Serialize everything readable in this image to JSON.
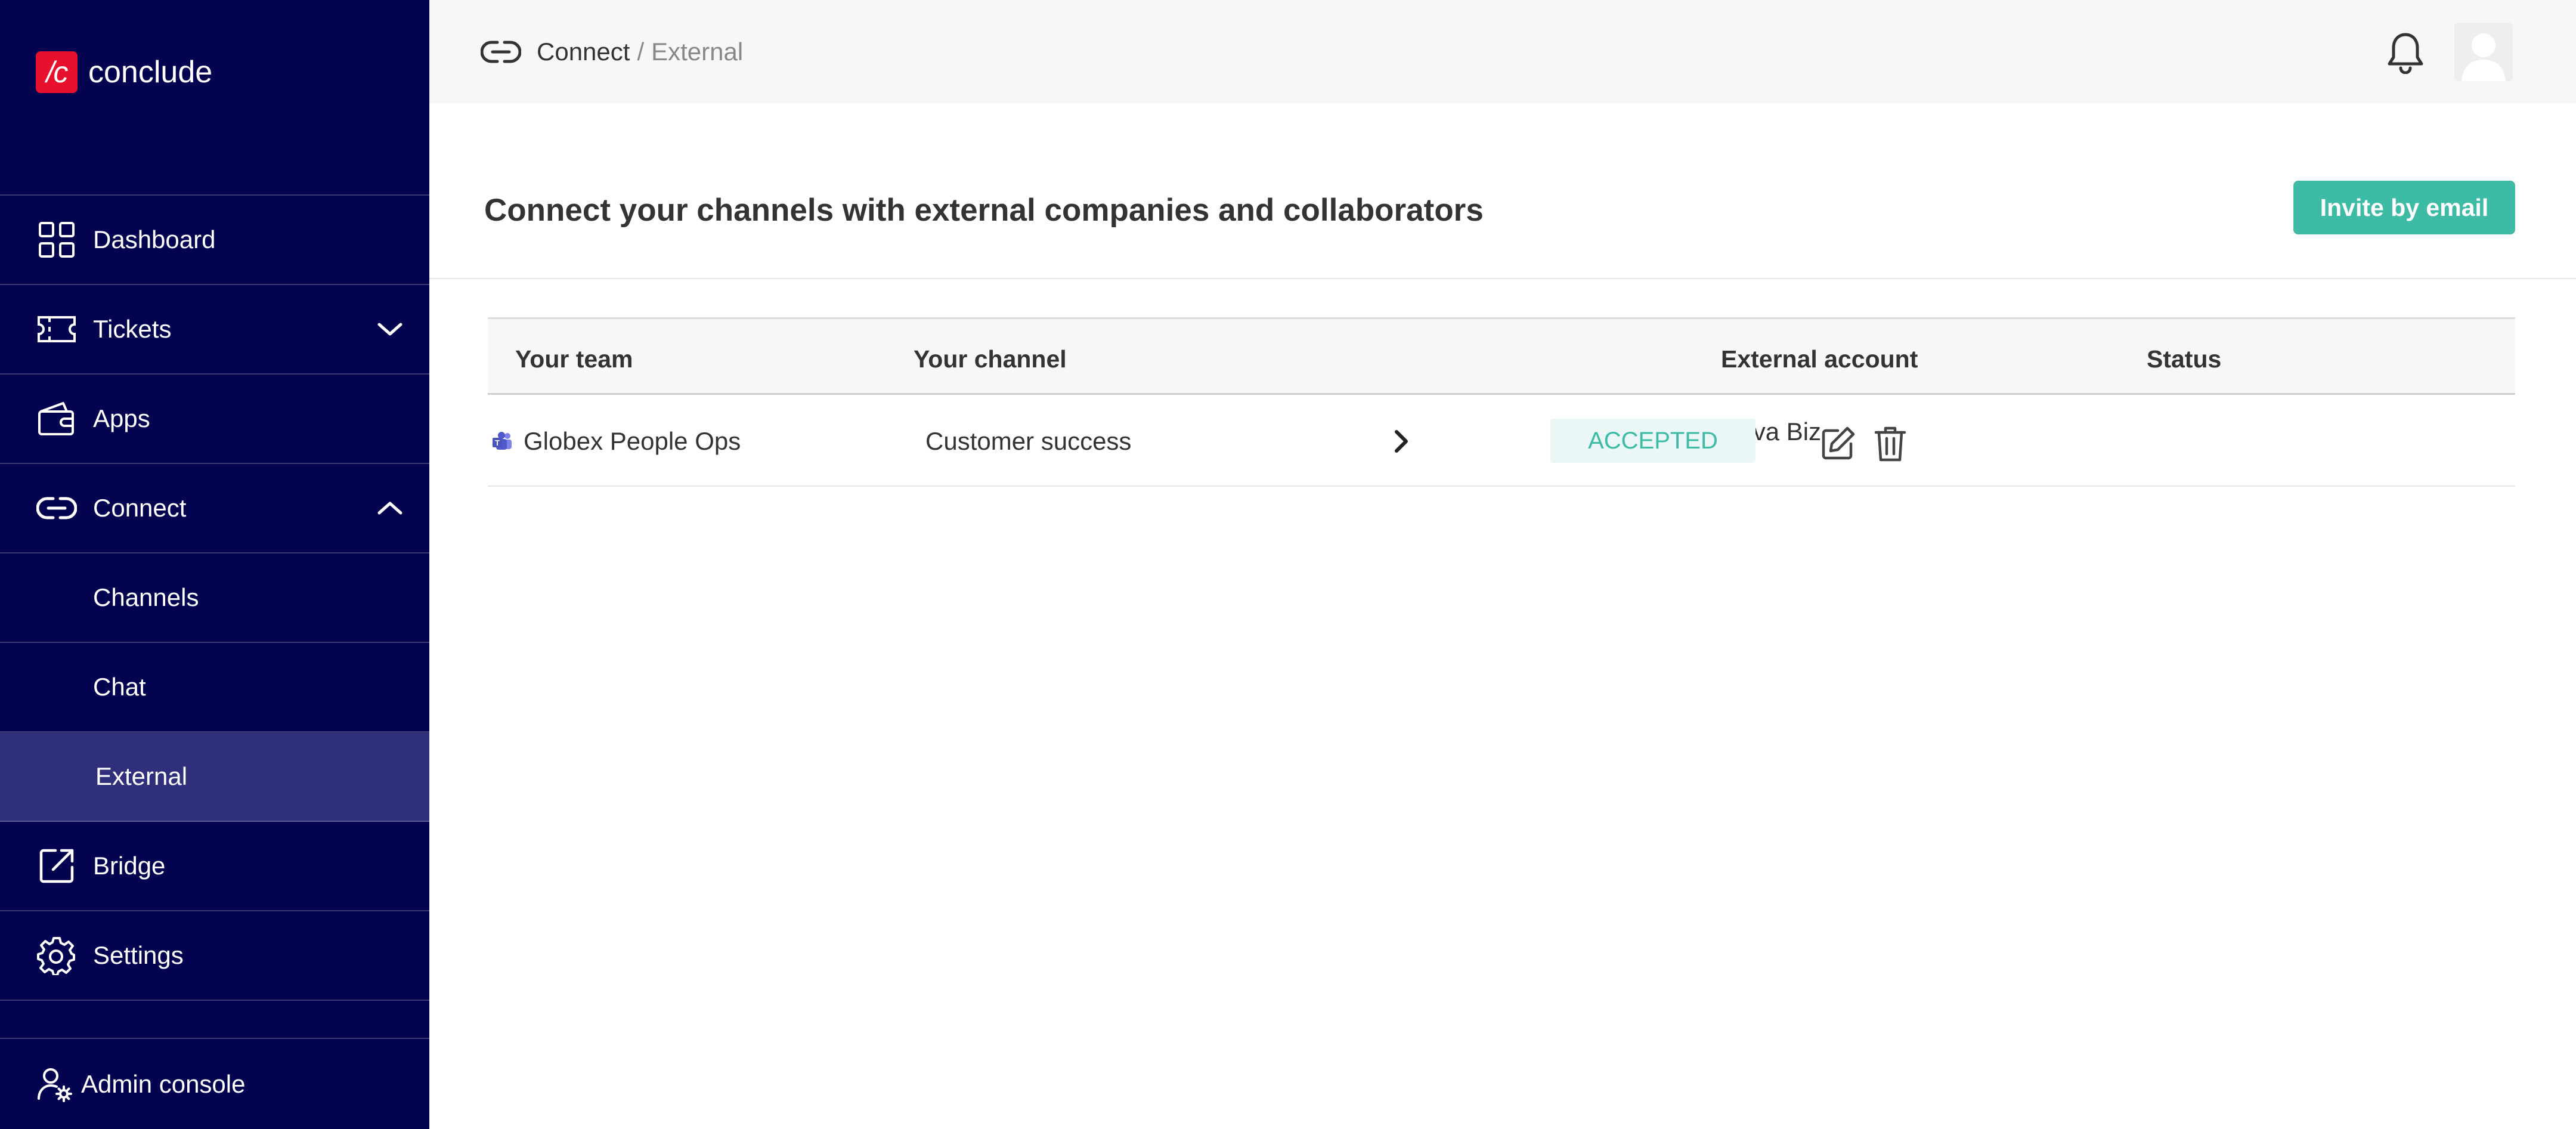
{
  "brand": {
    "logo_mark": "/c",
    "name": "conclude"
  },
  "sidebar": {
    "items": [
      {
        "label": "Dashboard",
        "icon": "grid-icon"
      },
      {
        "label": "Tickets",
        "icon": "ticket-icon",
        "chevron": "down"
      },
      {
        "label": "Apps",
        "icon": "wallet-icon"
      },
      {
        "label": "Connect",
        "icon": "link-icon",
        "chevron": "up"
      },
      {
        "label": "Channels",
        "sub": true
      },
      {
        "label": "Chat",
        "sub": true
      },
      {
        "label": "External",
        "sub": true,
        "active": true
      },
      {
        "label": "Bridge",
        "icon": "external-link-icon"
      },
      {
        "label": "Settings",
        "icon": "gear-icon"
      }
    ],
    "admin_label": "Admin console"
  },
  "topbar": {
    "crumb_section": "Connect",
    "crumb_separator": "/",
    "crumb_page": "External"
  },
  "main": {
    "headline": "Connect your channels with external companies and collaborators",
    "invite_label": "Invite by email"
  },
  "table": {
    "columns": [
      "Your team",
      "Your channel",
      "External account",
      "Status"
    ],
    "rows": [
      {
        "team": "Globex People Ops",
        "channel": "Customer success",
        "external_account": "Nova Biz",
        "status": "ACCEPTED"
      }
    ]
  },
  "colors": {
    "sidebar_bg": "#03034f",
    "sidebar_active": "#2f2f7c",
    "accent": "#3dbba4",
    "logo_red": "#e8112d"
  }
}
